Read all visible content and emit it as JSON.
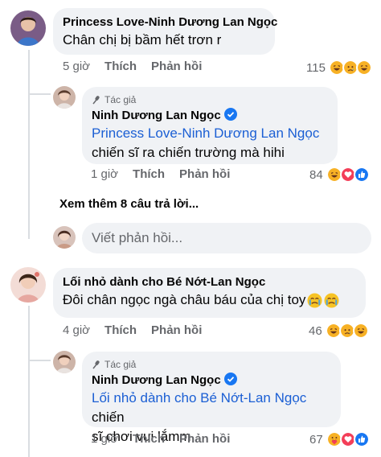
{
  "comments": [
    {
      "author": "Princess Love-Ninh Dương Lan Ngọc",
      "text": "Chân chị bị bầm hết trơn r",
      "time": "5 giờ",
      "like_label": "Thích",
      "reply_label": "Phản hồi",
      "reaction_count": "115",
      "reactions": [
        "haha",
        "sad",
        "haha"
      ]
    },
    {
      "author": "Lối nhỏ dành cho Bé Nớt-Lan Ngọc",
      "text": "Đôi chân ngọc ngà châu báu của chị toy",
      "time": "4 giờ",
      "like_label": "Thích",
      "reply_label": "Phản hồi",
      "reaction_count": "46",
      "reactions": [
        "haha",
        "sad",
        "haha"
      ]
    }
  ],
  "replies": [
    {
      "badge": "Tác giả",
      "author": "Ninh Dương Lan Ngọc",
      "mention": "Princess Love-Ninh Dương Lan Ngọc",
      "text": "chiến sĩ ra chiến trường mà hihi",
      "time": "1 giờ",
      "like_label": "Thích",
      "reply_label": "Phản hồi",
      "reaction_count": "84",
      "reactions": [
        "haha",
        "love",
        "like"
      ]
    },
    {
      "badge": "Tác giả",
      "author": "Ninh Dương Lan Ngọc",
      "mention": "Lối nhỏ dành cho Bé Nớt-Lan Ngọc",
      "text_inline": "chiến",
      "text": "sĩ chơi vui lắmm",
      "time": "1 giờ",
      "like_label": "Thích",
      "reply_label": "Phản hồi",
      "reaction_count": "67",
      "reactions": [
        "care",
        "love",
        "like"
      ]
    }
  ],
  "see_more": "Xem thêm 8 câu trả lời...",
  "reply_input": {
    "placeholder": "Viết phản hồi..."
  },
  "colors": {
    "mention": "#1b5fd4",
    "meta": "#65676b",
    "bubble": "#f0f2f5",
    "verified": "#1877f2"
  }
}
